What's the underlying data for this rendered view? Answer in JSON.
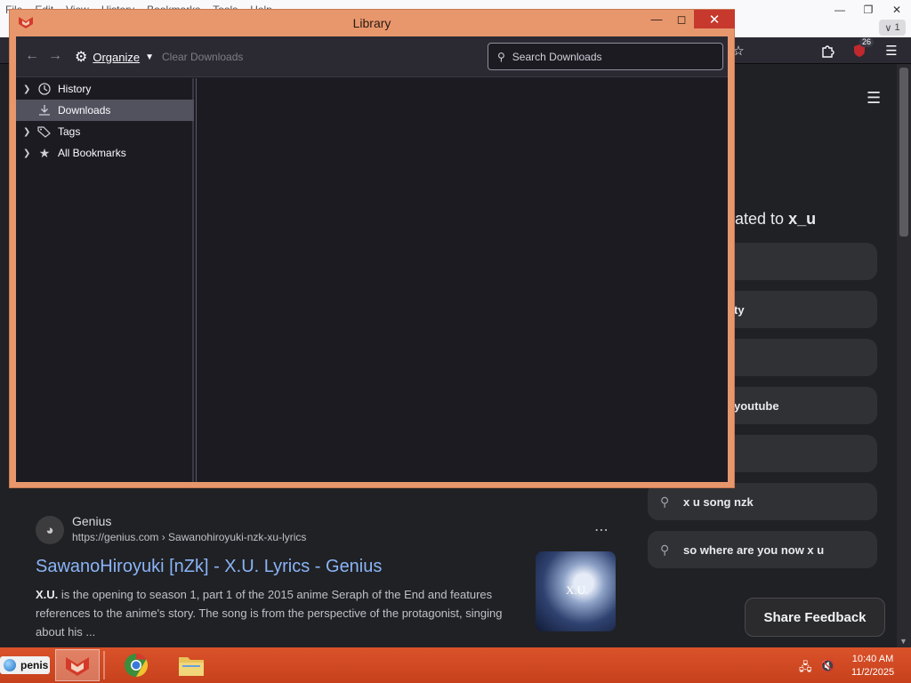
{
  "browser": {
    "menu": [
      "File",
      "Edit",
      "View",
      "History",
      "Bookmarks",
      "Tools",
      "Help"
    ],
    "tab_count": "1",
    "addon_badge": "26"
  },
  "related": {
    "title_prefix": "elated to ",
    "title_bold": "x_u",
    "items": [
      "",
      "ty",
      "",
      "youtube",
      "",
      "x u song nzk",
      "so where are you now x u"
    ]
  },
  "result": {
    "site_name": "Genius",
    "url": "https://genius.com › Sawanohiroyuki-nzk-xu-lyrics",
    "title": "SawanoHiroyuki [nZk] - X.U. Lyrics - Genius",
    "snippet_bold": "X.U.",
    "snippet": " is the opening to season 1, part 1 of the 2015 anime Seraph of the End and features references to the anime's story. The song is from the perspective of the protagonist, singing about his ...",
    "thumb_text": "X.U."
  },
  "share_feedback": "Share Feedback",
  "library": {
    "title": "Library",
    "organize": "Organize",
    "clear_downloads": "Clear Downloads",
    "search_placeholder": "Search Downloads",
    "sidebar": [
      {
        "label": "History",
        "icon": "clock-icon",
        "expandable": true,
        "selected": false
      },
      {
        "label": "Downloads",
        "icon": "download-icon",
        "expandable": false,
        "selected": true
      },
      {
        "label": "Tags",
        "icon": "tag-icon",
        "expandable": true,
        "selected": false
      },
      {
        "label": "All Bookmarks",
        "icon": "star-icon",
        "expandable": true,
        "selected": false
      }
    ]
  },
  "taskbar": {
    "start_label": "penis",
    "time": "10:40 AM",
    "date": "11/2/2025"
  }
}
